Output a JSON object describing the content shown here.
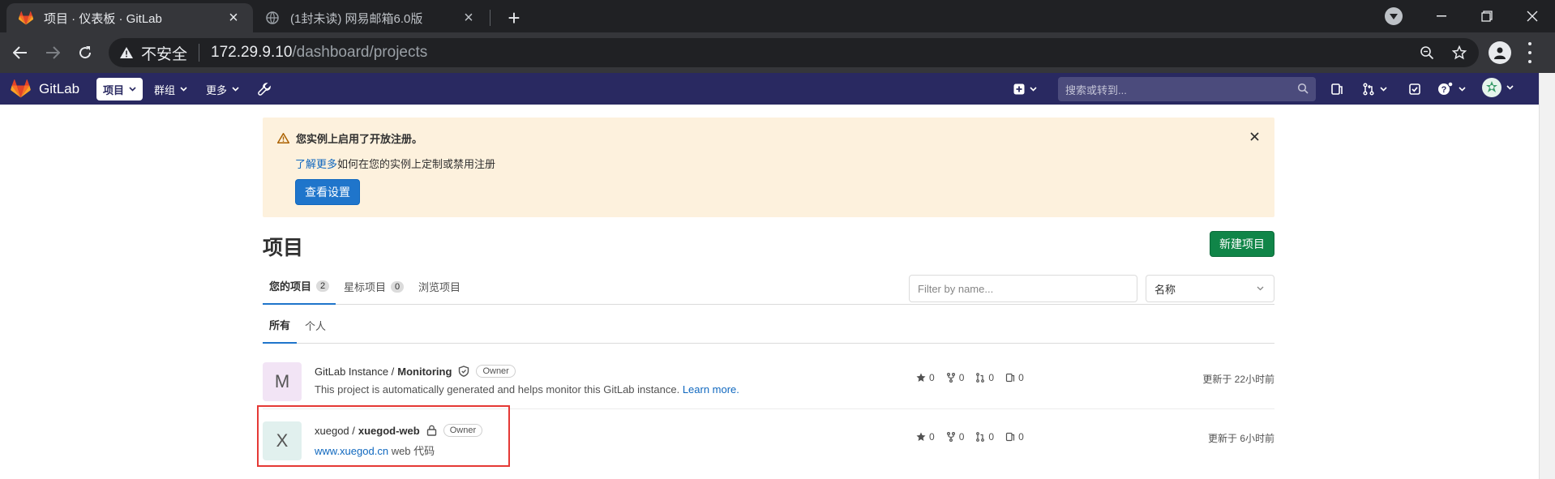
{
  "browser": {
    "tabs": [
      {
        "title": "项目 · 仪表板 · GitLab",
        "icon": "gitlab-favicon",
        "active": true
      },
      {
        "title": "(1封未读) 网易邮箱6.0版",
        "icon": "globe-favicon",
        "active": false
      }
    ],
    "new_tab_label": "+",
    "address": {
      "security_label": "不安全",
      "host": "172.29.9.10",
      "path": "/dashboard/projects"
    }
  },
  "gitlab_nav": {
    "brand": "GitLab",
    "menus": [
      {
        "label": "项目",
        "active": true
      },
      {
        "label": "群组",
        "active": false
      },
      {
        "label": "更多",
        "active": false
      }
    ],
    "search_placeholder": "搜索或转到..."
  },
  "alert": {
    "title": "您实例上启用了开放注册。",
    "link_text": "了解更多",
    "body_text": "如何在您的实例上定制或禁用注册",
    "button_label": "查看设置"
  },
  "page": {
    "title": "项目",
    "new_project_label": "新建项目",
    "tabs": [
      {
        "label": "您的项目",
        "count": "2",
        "active": true
      },
      {
        "label": "星标项目",
        "count": "0",
        "active": false
      },
      {
        "label": "浏览项目",
        "count": null,
        "active": false
      }
    ],
    "filter_placeholder": "Filter by name...",
    "sort_value": "名称",
    "subtabs": [
      {
        "label": "所有",
        "active": true
      },
      {
        "label": "个人",
        "active": false
      }
    ]
  },
  "projects": [
    {
      "avatar_letter": "M",
      "avatar_color": "#f2e4f5",
      "namespace": "GitLab Instance /",
      "name": "Monitoring",
      "visibility_icon": "shield-icon",
      "role": "Owner",
      "description": "This project is automatically generated and helps monitor this GitLab instance.",
      "description_link": "Learn more.",
      "stars": "0",
      "forks": "0",
      "merge_requests": "0",
      "issues": "0",
      "updated": "更新于 22小时前"
    },
    {
      "avatar_letter": "X",
      "avatar_color": "#e1f0ee",
      "namespace": "xuegod /",
      "name": "xuegod-web",
      "visibility_icon": "lock-icon",
      "role": "Owner",
      "description_link": "www.xuegod.cn",
      "description": "web 代码",
      "stars": "0",
      "forks": "0",
      "merge_requests": "0",
      "issues": "0",
      "updated": "更新于 6小时前"
    }
  ],
  "colors": {
    "nav_bg": "#292961",
    "alert_bg": "#fdf1dd",
    "primary": "#1f75cb",
    "success": "#108548",
    "highlight": "#e53935"
  }
}
